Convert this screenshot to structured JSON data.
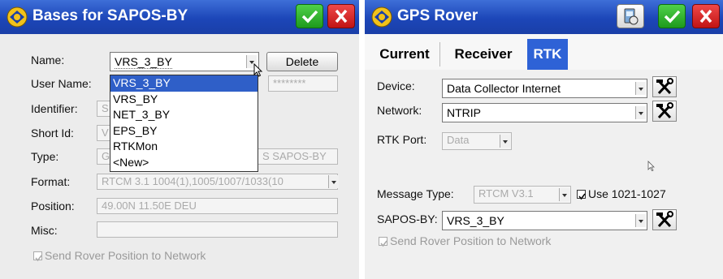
{
  "left": {
    "title": "Bases for SAPOS-BY",
    "fields": {
      "name_label": "Name:",
      "name_value": "VRS_3_BY",
      "delete_label": "Delete",
      "user_label": "User Name:",
      "password_value": "********",
      "identifier_label": "Identifier:",
      "identifier_value": "S",
      "shortid_label": "Short Id:",
      "shortid_value": "V",
      "type_label": "Type:",
      "type_value": "G",
      "type_value_right": "S SAPOS-BY",
      "format_label": "Format:",
      "format_value": "RTCM 3.1 1004(1),1005/1007/1033(10",
      "position_label": "Position:",
      "position_value": "49.00N 11.50E DEU",
      "misc_label": "Misc:",
      "send_label": "Send Rover Position to Network"
    },
    "dropdown": [
      "VRS_3_BY",
      "VRS_BY",
      "NET_3_BY",
      "EPS_BY",
      "RTKMon",
      "<New>"
    ]
  },
  "right": {
    "title": "GPS Rover",
    "tabs": [
      "Current",
      "Receiver",
      "RTK"
    ],
    "device_label": "Device:",
    "device_value": "Data Collector Internet",
    "network_label": "Network:",
    "network_value": "NTRIP",
    "rtkport_label": "RTK Port:",
    "rtkport_value": "Data",
    "msgtype_label": "Message Type:",
    "msgtype_value": "RTCM V3.1",
    "use_label": "Use 1021-1027",
    "sapos_label": "SAPOS-BY:",
    "sapos_value": "VRS_3_BY",
    "send_label": "Send Rover Position to Network"
  },
  "icons": {
    "ok": "checkmark-icon",
    "cancel": "close-icon",
    "settings": "wrench-hammer-icon",
    "tool": "device-settings-icon"
  },
  "colors": {
    "titlebar": "#1c46b8",
    "ok": "#1e9a1c",
    "cancel": "#c11414",
    "selection": "#2f5fc8"
  }
}
